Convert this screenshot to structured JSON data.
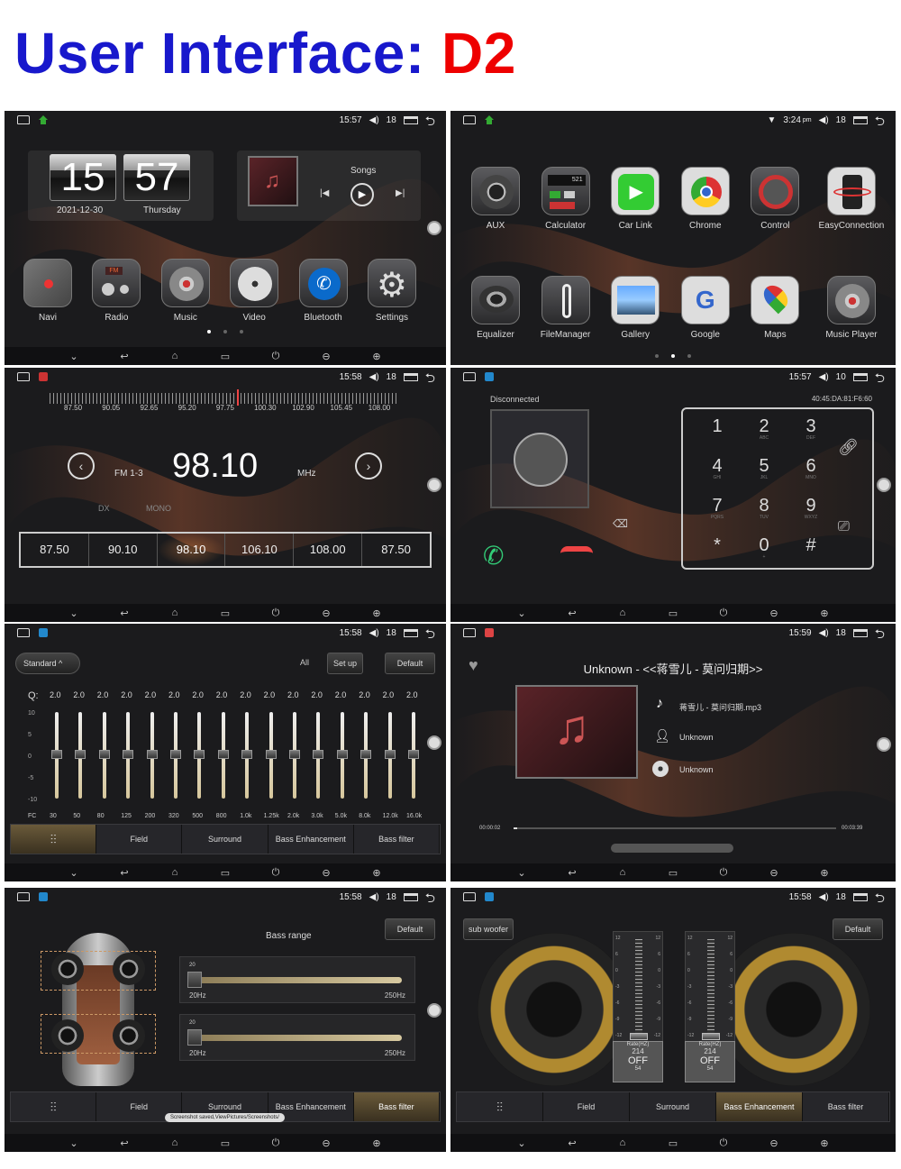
{
  "title": {
    "part1": "User Interface: ",
    "part2": "D2"
  },
  "colors": {
    "title_blue": "#1818cc",
    "title_red": "#e00000"
  },
  "panel_home": {
    "time": "15:57",
    "volume": "18",
    "clock_hour": "15",
    "clock_min": "57",
    "date": "2021-12-30",
    "weekday": "Thursday",
    "music_title": "Songs",
    "apps": [
      "Navi",
      "Radio",
      "Music",
      "Video",
      "Bluetooth",
      "Settings"
    ]
  },
  "panel_apps": {
    "time": "3:24",
    "time_suffix": "pm",
    "volume": "18",
    "calc_display": "521",
    "apps_row1": [
      "AUX",
      "Calculator",
      "Car Link",
      "Chrome",
      "Control",
      "EasyConnection"
    ],
    "apps_row2": [
      "Equalizer",
      "FileManager",
      "Gallery",
      "Google",
      "Maps",
      "Music Player"
    ]
  },
  "panel_radio": {
    "time": "15:58",
    "volume": "18",
    "scale": [
      "87.50",
      "90.05",
      "92.65",
      "95.20",
      "97.75",
      "100.30",
      "102.90",
      "105.45",
      "108.00"
    ],
    "band": "FM 1-3",
    "frequency": "98.10",
    "unit": "MHz",
    "dx": "DX",
    "mono": "MONO",
    "presets": [
      "87.50",
      "90.10",
      "98.10",
      "106.10",
      "108.00",
      "87.50"
    ]
  },
  "panel_phone": {
    "time": "15:57",
    "volume": "10",
    "status": "Disconnected",
    "mac": "40:45:DA:81:F6:60",
    "keys": [
      {
        "d": "1",
        "s": ""
      },
      {
        "d": "2",
        "s": "ABC"
      },
      {
        "d": "3",
        "s": "DEF"
      },
      {
        "d": "4",
        "s": "GHI"
      },
      {
        "d": "5",
        "s": "JKL"
      },
      {
        "d": "6",
        "s": "MNO"
      },
      {
        "d": "7",
        "s": "PQRS"
      },
      {
        "d": "8",
        "s": "TUV"
      },
      {
        "d": "9",
        "s": "WXYZ"
      },
      {
        "d": "*",
        "s": ""
      },
      {
        "d": "0",
        "s": "+"
      },
      {
        "d": "#",
        "s": ""
      }
    ]
  },
  "panel_eq": {
    "time": "15:58",
    "volume": "18",
    "preset": "Standard",
    "all": "All",
    "setup": "Set up",
    "default": "Default",
    "q_label": "Q:",
    "q_values": [
      "2.0",
      "2.0",
      "2.0",
      "2.0",
      "2.0",
      "2.0",
      "2.0",
      "2.0",
      "2.0",
      "2.0",
      "2.0",
      "2.0",
      "2.0",
      "2.0",
      "2.0",
      "2.0"
    ],
    "scale": [
      "10",
      "5",
      "0",
      "-5",
      "-10"
    ],
    "band_levels": [
      0,
      0,
      0,
      0,
      0,
      0,
      0,
      0,
      0,
      0,
      0,
      0,
      0,
      0,
      0,
      0
    ],
    "freq_labels": [
      "FC",
      "30",
      "50",
      "80",
      "125",
      "200",
      "320",
      "500",
      "800",
      "1.0k",
      "1.25k",
      "2.0k",
      "3.0k",
      "5.0k",
      "8.0k",
      "12.0k",
      "16.0k"
    ],
    "tabs": [
      "",
      "Field",
      "Surround",
      "Bass Enhancement",
      "Bass filter"
    ]
  },
  "panel_music": {
    "time": "15:59",
    "volume": "18",
    "header": "Unknown - <<蒋雪儿 - 莫问归期>>",
    "file": "蒋雪儿 - 莫问归期.mp3",
    "artist": "Unknown",
    "album": "Unknown",
    "elapsed": "00:00:02",
    "total": "00:03:39",
    "progress": 0.01
  },
  "panel_field": {
    "time": "15:58",
    "volume": "18",
    "default": "Default",
    "title": "Bass range",
    "slider1": {
      "value": "20",
      "min": "20Hz",
      "max": "250Hz"
    },
    "slider2": {
      "value": "20",
      "min": "20Hz",
      "max": "250Hz"
    },
    "tabs": [
      "",
      "Field",
      "Surround",
      "Bass Enhancement",
      "Bass filter"
    ],
    "toast": "Screenshot saved,ViewPictures/Screenshots/"
  },
  "panel_sub": {
    "time": "15:58",
    "volume": "18",
    "sub_woofer": "sub woofer",
    "default": "Default",
    "meter_scale": [
      "12",
      "6",
      "0",
      "-3",
      "-6",
      "-9",
      "-12"
    ],
    "rate_label": "Rate(HZ)",
    "rate_value": "214",
    "rate_sub": "54",
    "off": "OFF",
    "tabs": [
      "",
      "Field",
      "Surround",
      "Bass Enhancement",
      "Bass filter"
    ]
  }
}
